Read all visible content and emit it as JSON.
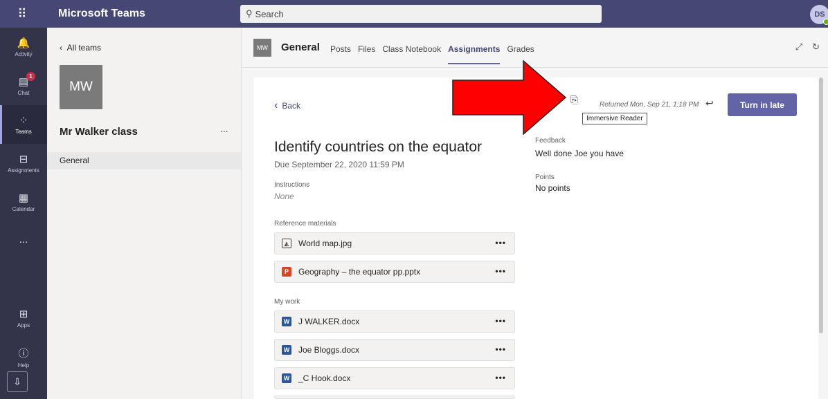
{
  "app": {
    "title": "Microsoft Teams",
    "user_initials": "DS"
  },
  "search": {
    "placeholder": "Search"
  },
  "rail": {
    "items": [
      {
        "label": "Activity",
        "icon": "bell-icon"
      },
      {
        "label": "Chat",
        "icon": "chat-icon",
        "badge": "1"
      },
      {
        "label": "Teams",
        "icon": "teams-icon",
        "active": true
      },
      {
        "label": "Assignments",
        "icon": "assignments-icon"
      },
      {
        "label": "Calendar",
        "icon": "calendar-icon"
      }
    ],
    "more": "...",
    "bottom": [
      {
        "label": "Apps",
        "icon": "apps-icon"
      },
      {
        "label": "Help",
        "icon": "help-icon"
      }
    ]
  },
  "team_pane": {
    "back_label": "All teams",
    "tile_initials": "MW",
    "team_name": "Mr Walker class",
    "more": "...",
    "channels": [
      "General"
    ]
  },
  "header": {
    "tile_initials": "MW",
    "channel_name": "General",
    "tabs": [
      {
        "label": "Posts"
      },
      {
        "label": "Files"
      },
      {
        "label": "Class Notebook"
      },
      {
        "label": "Assignments",
        "active": true
      },
      {
        "label": "Grades"
      }
    ]
  },
  "assignment": {
    "back_label": "Back",
    "title": "Identify countries on the equator",
    "due": "Due September 22, 2020 11:59 PM",
    "instructions_label": "Instructions",
    "instructions_value": "None",
    "reference_label": "Reference materials",
    "reference_files": [
      {
        "name": "World map.jpg",
        "icon": "image-icon"
      },
      {
        "name": "Geography – the equator pp.pptx",
        "icon": "powerpoint-icon"
      }
    ],
    "my_work_label": "My work",
    "my_work_files": [
      {
        "name": "J WALKER.docx",
        "icon": "word-icon"
      },
      {
        "name": "Joe Bloggs.docx",
        "icon": "word-icon"
      },
      {
        "name": "_C Hook.docx",
        "icon": "word-icon"
      }
    ],
    "file_more": "•••",
    "immersive_reader_tooltip": "Immersive Reader",
    "returned_text": "Returned Mon, Sep 21, 1:18 PM",
    "turn_in_label": "Turn in late",
    "feedback_label": "Feedback",
    "feedback_text": "Well done Joe you have",
    "points_label": "Points",
    "points_text": "No points"
  },
  "colors": {
    "brand": "#464775",
    "accent": "#6264a7",
    "annotation_arrow": "#ff0000"
  }
}
